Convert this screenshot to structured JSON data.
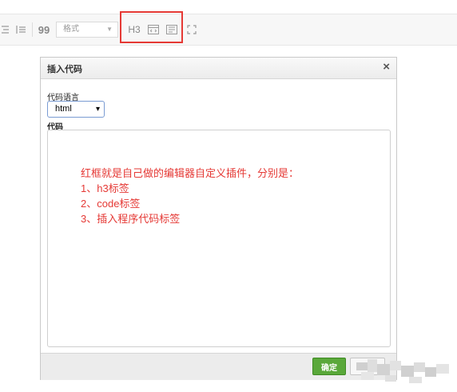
{
  "toolbar": {
    "format_placeholder": "格式",
    "h3_label": "H3",
    "quote_label": "99",
    "icons": [
      "align-icon",
      "indent-icon",
      "quote-icon",
      "h3-icon",
      "code-icon",
      "insert-code-icon",
      "fullscreen-icon"
    ],
    "highlight_color": "#e53935"
  },
  "dialog": {
    "title": "插入代码",
    "close_label": "×",
    "language_label": "代码语言",
    "language_value": "html",
    "code_label": "代码",
    "code_lines": [
      "红框就是自己做的编辑器自定义插件，分别是：",
      "1、h3标签",
      "2、code标签",
      "3、插入程序代码标签"
    ],
    "ok_label": "确定",
    "ok_color": "#5aa83a",
    "code_text_color": "#e53935"
  }
}
